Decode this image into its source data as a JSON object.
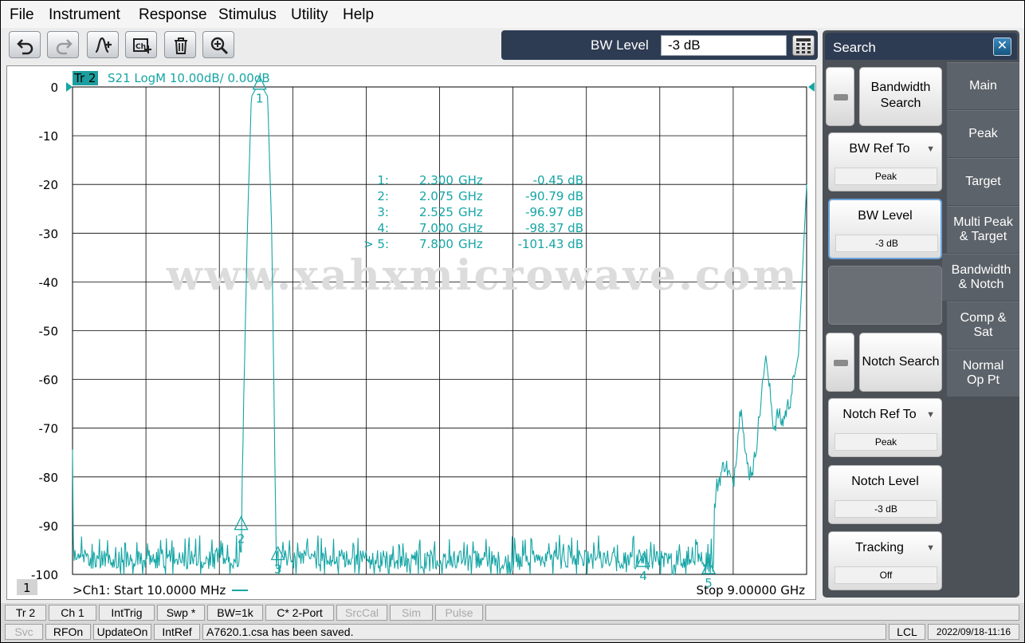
{
  "menu": [
    "File",
    "Instrument",
    "Response",
    "Stimulus",
    "Utility",
    "Help"
  ],
  "toolbar": {
    "buttons": [
      "undo-icon",
      "redo-icon",
      "marker-add-icon",
      "display-add-icon",
      "trash-icon",
      "zoom-icon"
    ],
    "bw_level_label": "BW Level",
    "bw_level_value": "-3 dB"
  },
  "trace": {
    "tag": "Tr 2",
    "description": "S21 LogM 10.00dB/  0.00dB",
    "color": "#16a5a5"
  },
  "channel_number": "1",
  "start_label": ">Ch1:  Start  10.0000 MHz",
  "stop_label": "Stop  9.00000 GHz",
  "watermark": "www.xahxmicrowave.com",
  "markers": [
    {
      "num": "1:",
      "freq": "2.300",
      "unit": "GHz",
      "value": "-0.45 dB"
    },
    {
      "num": "2:",
      "freq": "2.075",
      "unit": "GHz",
      "value": "-90.79 dB"
    },
    {
      "num": "3:",
      "freq": "2.525",
      "unit": "GHz",
      "value": "-96.97 dB"
    },
    {
      "num": "4:",
      "freq": "7.000",
      "unit": "GHz",
      "value": "-98.37 dB"
    },
    {
      "num": "> 5:",
      "freq": "7.800",
      "unit": "GHz",
      "value": "-101.43 dB"
    }
  ],
  "chart_data": {
    "type": "line",
    "xlabel": "",
    "ylabel": "",
    "xlim_ghz": [
      0.01,
      9.0
    ],
    "ylim": [
      -100,
      0
    ],
    "y_ticks": [
      "0",
      "-10",
      "-20",
      "-30",
      "-40",
      "-50",
      "-60",
      "-70",
      "-80",
      "-90",
      "-100"
    ],
    "grid": true,
    "series": [
      {
        "name": "",
        "x_ghz": [
          0.01,
          0.02,
          0.05,
          0.5,
          1.0,
          1.5,
          2.0,
          2.075,
          2.15,
          2.2,
          2.25,
          2.3,
          2.35,
          2.4,
          2.45,
          2.5,
          2.525,
          2.6,
          3.0,
          4.0,
          5.0,
          6.0,
          7.0,
          7.5,
          7.8,
          7.85,
          7.9,
          8.0,
          8.1,
          8.2,
          8.25,
          8.3,
          8.35,
          8.4,
          8.5,
          8.6,
          8.65,
          8.7,
          8.8,
          8.9,
          9.0
        ],
        "y_db": [
          -75,
          -90,
          -97,
          -97,
          -96,
          -96,
          -96,
          -90.79,
          -30,
          -2,
          -0.5,
          -0.45,
          -0.5,
          -2,
          -30,
          -90,
          -96.97,
          -98,
          -98,
          -98,
          -98,
          -98,
          -98.37,
          -97,
          -101.43,
          -90,
          -82,
          -77,
          -82,
          -64,
          -76,
          -79,
          -78,
          -71,
          -55,
          -70,
          -67,
          -69,
          -64,
          -55,
          -20
        ]
      }
    ],
    "marker_points": [
      {
        "label": "1",
        "x_ghz": 2.3,
        "y_db": -0.45
      },
      {
        "label": "2",
        "x_ghz": 2.075,
        "y_db": -90.79
      },
      {
        "label": "3",
        "x_ghz": 2.525,
        "y_db": -96.97
      },
      {
        "label": "4",
        "x_ghz": 7.0,
        "y_db": -98.37
      },
      {
        "label": "5",
        "x_ghz": 7.8,
        "y_db": -101.43
      }
    ]
  },
  "softkeys": {
    "title": "Search",
    "bandwidth_search": "Bandwidth Search",
    "bw_ref_to": "BW Ref To",
    "bw_ref_to_value": "Peak",
    "bw_level": "BW Level",
    "bw_level_value": "-3 dB",
    "notch_search": "Notch Search",
    "notch_ref_to": "Notch Ref To",
    "notch_ref_to_value": "Peak",
    "notch_level": "Notch Level",
    "notch_level_value": "-3 dB",
    "tracking": "Tracking",
    "tracking_value": "Off"
  },
  "tabs": [
    "Main",
    "Peak",
    "Target",
    "Multi Peak & Target",
    "Bandwidth & Notch",
    "Comp & Sat",
    "Normal Op Pt"
  ],
  "status_row1": [
    "Tr 2",
    "Ch 1",
    "IntTrig",
    "Swp *",
    "BW=1k",
    "C* 2-Port",
    "SrcCal",
    "Sim",
    "Pulse"
  ],
  "status_row2": [
    "Svc",
    "RFOn",
    "UpdateOn",
    "IntRef"
  ],
  "status_message": "A7620.1.csa has been saved.",
  "status_lcl": "LCL",
  "status_datetime": "2022/09/18-11:16"
}
